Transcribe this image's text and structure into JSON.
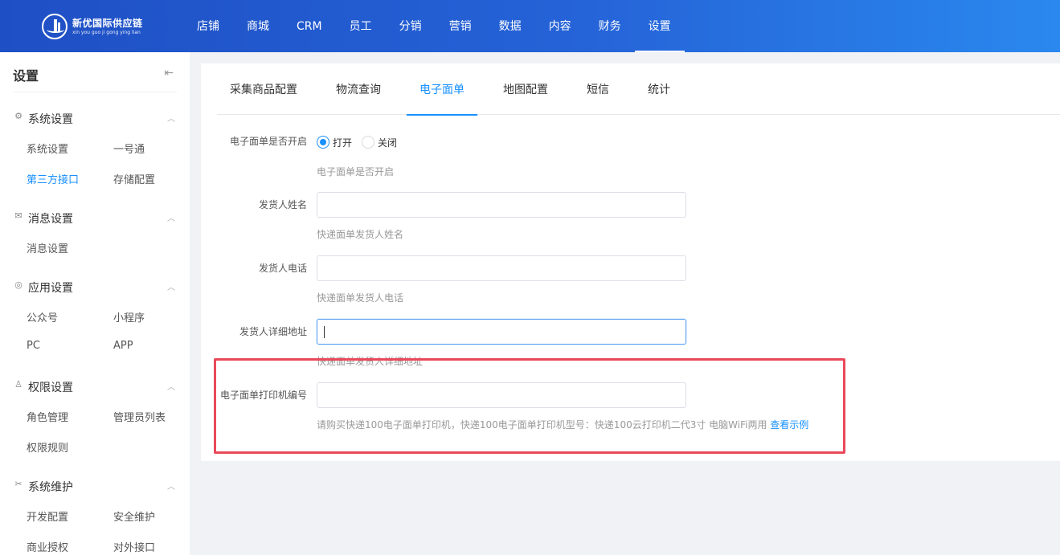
{
  "brand": {
    "name": "新优国际供应链",
    "subtitle": "xin you guo ji gong ying lian"
  },
  "nav": [
    "店铺",
    "商城",
    "CRM",
    "员工",
    "分销",
    "营销",
    "数据",
    "内容",
    "财务",
    "设置"
  ],
  "nav_active": "设置",
  "sidebar": {
    "title": "设置",
    "collapse_icon": "collapse-left-icon",
    "groups": [
      {
        "label": "系统设置",
        "icon": "gear-icon",
        "items": [
          "系统设置",
          "一号通",
          "第三方接口",
          "存储配置"
        ]
      },
      {
        "label": "消息设置",
        "icon": "message-icon",
        "items": [
          "消息设置"
        ]
      },
      {
        "label": "应用设置",
        "icon": "app-icon",
        "items": [
          "公众号",
          "小程序",
          "PC",
          "APP"
        ]
      },
      {
        "label": "权限设置",
        "icon": "user-icon",
        "items": [
          "角色管理",
          "管理员列表",
          "权限规则"
        ]
      },
      {
        "label": "系统维护",
        "icon": "tools-icon",
        "items": [
          "开发配置",
          "安全维护",
          "商业授权",
          "对外接口"
        ]
      }
    ],
    "active_item": "第三方接口"
  },
  "tabs": [
    "采集商品配置",
    "物流查询",
    "电子面单",
    "地图配置",
    "短信",
    "统计"
  ],
  "active_tab": "电子面单",
  "form": {
    "enable": {
      "label": "电子面单是否开启",
      "options": [
        "打开",
        "关闭"
      ],
      "selected": "打开",
      "help": "电子面单是否开启"
    },
    "sender_name": {
      "label": "发货人姓名",
      "value": "",
      "help": "快递面单发货人姓名"
    },
    "sender_phone": {
      "label": "发货人电话",
      "value": "",
      "help": "快递面单发货人电话"
    },
    "sender_address": {
      "label": "发货人详细地址",
      "value": "",
      "help": "快递面单发货人详细地址"
    },
    "printer_no": {
      "label": "电子面单打印机编号",
      "value": "",
      "help": "请购买快递100电子面单打印机，快递100电子面单打印机型号：快递100云打印机二代3寸 电脑WiFi两用",
      "help_link": "查看示例"
    }
  },
  "colors": {
    "accent": "#1890ff",
    "header_start": "#1f4fc4",
    "header_end": "#2a88ee",
    "highlight": "#e9495a"
  }
}
